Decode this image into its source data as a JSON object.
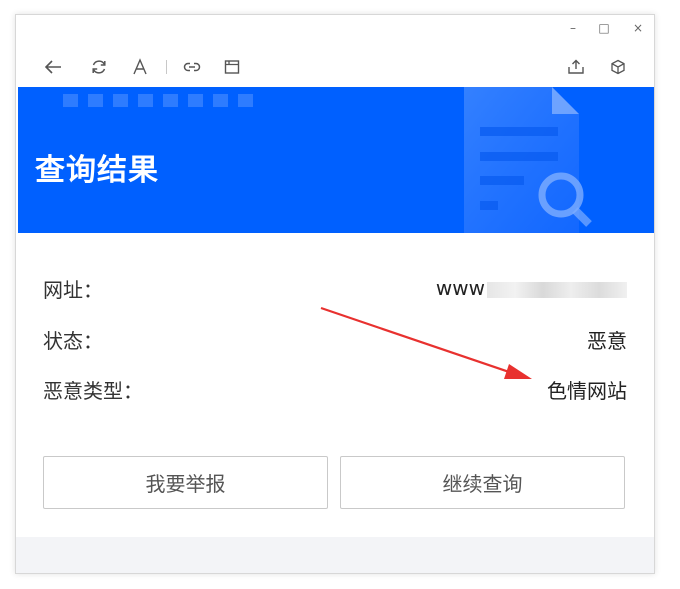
{
  "window": {
    "controls": {
      "minimize": "–",
      "maximize": "□",
      "close": "×"
    }
  },
  "toolbar": {
    "icons": [
      "back-arrow-icon",
      "refresh-icon",
      "font-icon",
      "link-icon",
      "window-icon",
      "share-icon",
      "cube-icon"
    ]
  },
  "banner": {
    "title": "查询结果",
    "color": "#0060ff"
  },
  "result": {
    "url_label": "网址：",
    "url_value": "www",
    "status_label": "状态：",
    "status_value": "恶意",
    "type_label": "恶意类型：",
    "type_value": "色情网站"
  },
  "actions": {
    "report_label": "我要举报",
    "continue_label": "继续查询"
  },
  "annotation": {
    "arrow_color": "#e8312f"
  }
}
